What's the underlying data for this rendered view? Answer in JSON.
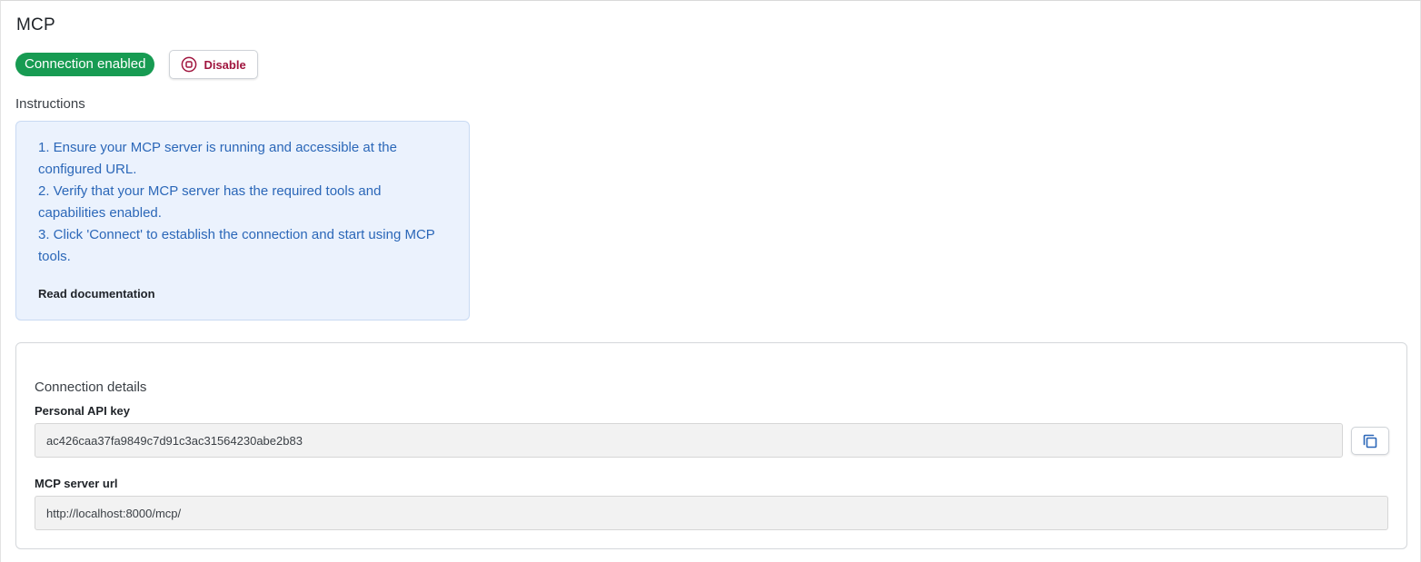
{
  "header": {
    "title": "MCP"
  },
  "status": {
    "badge_label": "Connection enabled",
    "badge_color": "#179b52",
    "disable_label": "Disable",
    "disable_color": "#a0153e"
  },
  "instructions": {
    "label": "Instructions",
    "steps": [
      "1. Ensure your MCP server is running and accessible at the configured URL.",
      "2. Verify that your MCP server has the required tools and capabilities enabled.",
      "3. Click 'Connect' to establish the connection and start using MCP tools."
    ],
    "docs_link_label": "Read documentation",
    "box_color": "#ebf2fd",
    "text_color": "#2b67b8"
  },
  "connection_details": {
    "heading": "Connection details",
    "api_key_label": "Personal API key",
    "api_key_value": "ac426caa37fa9849c7d91c3ac31564230abe2b83",
    "server_url_label": "MCP server url",
    "server_url_value": "http://localhost:8000/mcp/",
    "copy_icon": "copy-icon"
  }
}
